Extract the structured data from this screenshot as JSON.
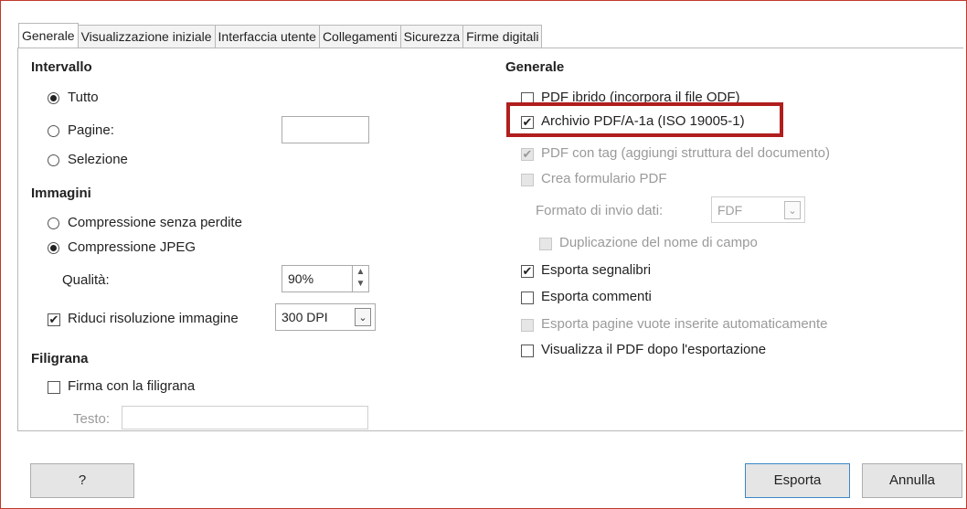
{
  "tabs": [
    "Generale",
    "Visualizzazione iniziale",
    "Interfaccia utente",
    "Collegamenti",
    "Sicurezza",
    "Firme digitali"
  ],
  "left": {
    "intervallo": {
      "header": "Intervallo",
      "tutto": "Tutto",
      "pagine": "Pagine:",
      "pagine_value": "",
      "selezione": "Selezione"
    },
    "immagini": {
      "header": "Immagini",
      "lossless": "Compressione senza perdite",
      "jpeg": "Compressione JPEG",
      "qualita_label": "Qualità:",
      "qualita_value": "90%",
      "riduci": "Riduci risoluzione immagine",
      "dpi_value": "300 DPI"
    },
    "filigrana": {
      "header": "Filigrana",
      "firma": "Firma con la filigrana",
      "testo_label": "Testo:",
      "testo_value": ""
    }
  },
  "right": {
    "header": "Generale",
    "pdf_ibrido": "PDF ibrido (incorpora il file ODF)",
    "archivio": "Archivio PDF/A-1a (ISO 19005-1)",
    "pdf_tag": "PDF con tag (aggiungi struttura del documento)",
    "formulario": "Crea formulario PDF",
    "formato_label": "Formato di invio dati:",
    "formato_value": "FDF",
    "duplicazione": "Duplicazione del nome di campo",
    "segnalibri": "Esporta segnalibri",
    "commenti": "Esporta commenti",
    "pagine_vuote": "Esporta pagine vuote inserite automaticamente",
    "visualizza": "Visualizza il PDF dopo l'esportazione"
  },
  "buttons": {
    "help": "?",
    "export": "Esporta",
    "cancel": "Annulla"
  },
  "colors": {
    "highlight": "#b01e1e",
    "frame": "#c0392b"
  }
}
